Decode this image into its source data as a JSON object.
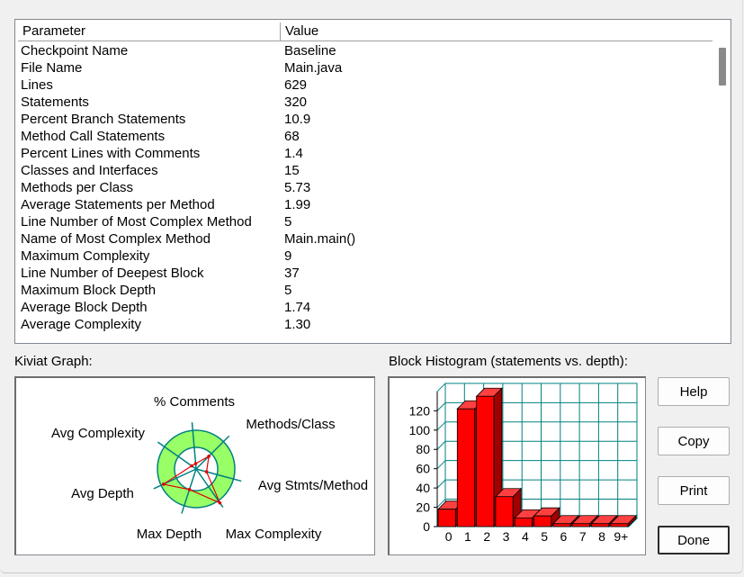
{
  "table": {
    "columns": [
      "Parameter",
      "Value"
    ],
    "rows": [
      {
        "param": "Checkpoint Name",
        "value": "Baseline"
      },
      {
        "param": "File Name",
        "value": "Main.java"
      },
      {
        "param": "Lines",
        "value": "629"
      },
      {
        "param": "Statements",
        "value": "320"
      },
      {
        "param": "Percent Branch Statements",
        "value": "10.9"
      },
      {
        "param": "Method Call Statements",
        "value": "68"
      },
      {
        "param": "Percent Lines with Comments",
        "value": "1.4"
      },
      {
        "param": "Classes and Interfaces",
        "value": "15"
      },
      {
        "param": "Methods per Class",
        "value": "5.73"
      },
      {
        "param": "Average Statements per Method",
        "value": "1.99"
      },
      {
        "param": "Line Number of Most Complex Method",
        "value": "5"
      },
      {
        "param": "Name of Most Complex Method",
        "value": "Main.main()"
      },
      {
        "param": "Maximum Complexity",
        "value": "9"
      },
      {
        "param": "Line Number of Deepest Block",
        "value": "37"
      },
      {
        "param": "Maximum Block Depth",
        "value": "5"
      },
      {
        "param": "Average Block Depth",
        "value": "1.74"
      },
      {
        "param": "Average Complexity",
        "value": "1.30"
      }
    ]
  },
  "kiviat": {
    "label": "Kiviat Graph:",
    "axes": [
      "% Comments",
      "Methods/Class",
      "Avg Stmts/Method",
      "Max Complexity",
      "Max Depth",
      "Avg Depth",
      "Avg Complexity"
    ],
    "colors": {
      "band": "#99ff66",
      "line": "#e00000",
      "axis": "#008080"
    }
  },
  "histogram": {
    "label": "Block Histogram (statements vs. depth):",
    "bar_color": "#ff0000",
    "grid_color": "#008080"
  },
  "buttons": {
    "help": "Help",
    "copy": "Copy",
    "print": "Print",
    "done": "Done"
  },
  "chart_data": {
    "type": "bar",
    "title": "Block Histogram (statements vs. depth):",
    "categories": [
      "0",
      "1",
      "2",
      "3",
      "4",
      "5",
      "6",
      "7",
      "8",
      "9+"
    ],
    "values": [
      18,
      122,
      135,
      31,
      9,
      11,
      3,
      3,
      3,
      3
    ],
    "ylim": [
      0,
      140
    ],
    "yticks": [
      0,
      20,
      40,
      60,
      80,
      100,
      120
    ],
    "grid": true
  }
}
